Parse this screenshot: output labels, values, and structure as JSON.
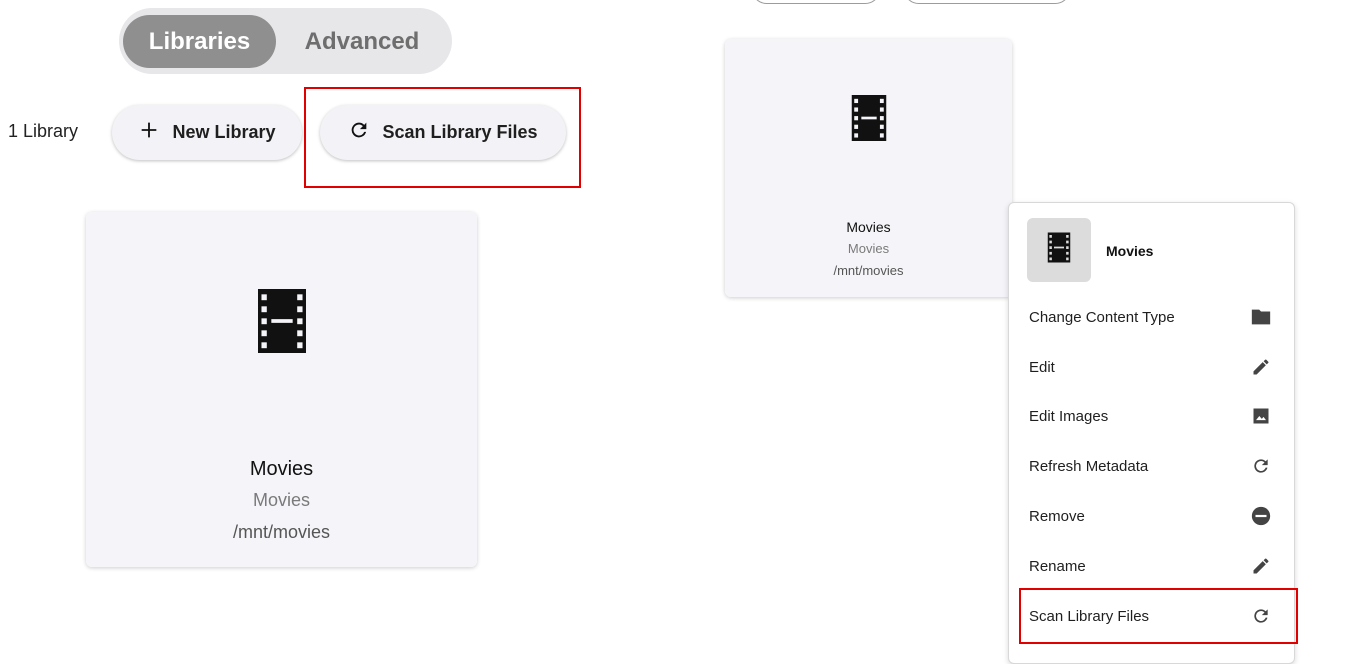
{
  "tabs": {
    "libraries": "Libraries",
    "advanced": "Advanced"
  },
  "toolbar": {
    "count": "1 Library",
    "new_library": "New Library",
    "scan_library_files": "Scan Library Files"
  },
  "library_card": {
    "name": "Movies",
    "type": "Movies",
    "path": "/mnt/movies",
    "icon": "film-icon"
  },
  "context_menu": {
    "title": "Movies",
    "items": [
      {
        "label": "Change Content Type",
        "icon": "folder-icon"
      },
      {
        "label": "Edit",
        "icon": "pencil-icon"
      },
      {
        "label": "Edit Images",
        "icon": "image-icon"
      },
      {
        "label": "Refresh Metadata",
        "icon": "refresh-icon"
      },
      {
        "label": "Remove",
        "icon": "remove-icon"
      },
      {
        "label": "Rename",
        "icon": "pencil-icon"
      },
      {
        "label": "Scan Library Files",
        "icon": "refresh-icon"
      }
    ]
  },
  "colors": {
    "highlight": "#e00000",
    "active_tab": "#8f8f8f",
    "card_bg": "#f5f4f8"
  }
}
